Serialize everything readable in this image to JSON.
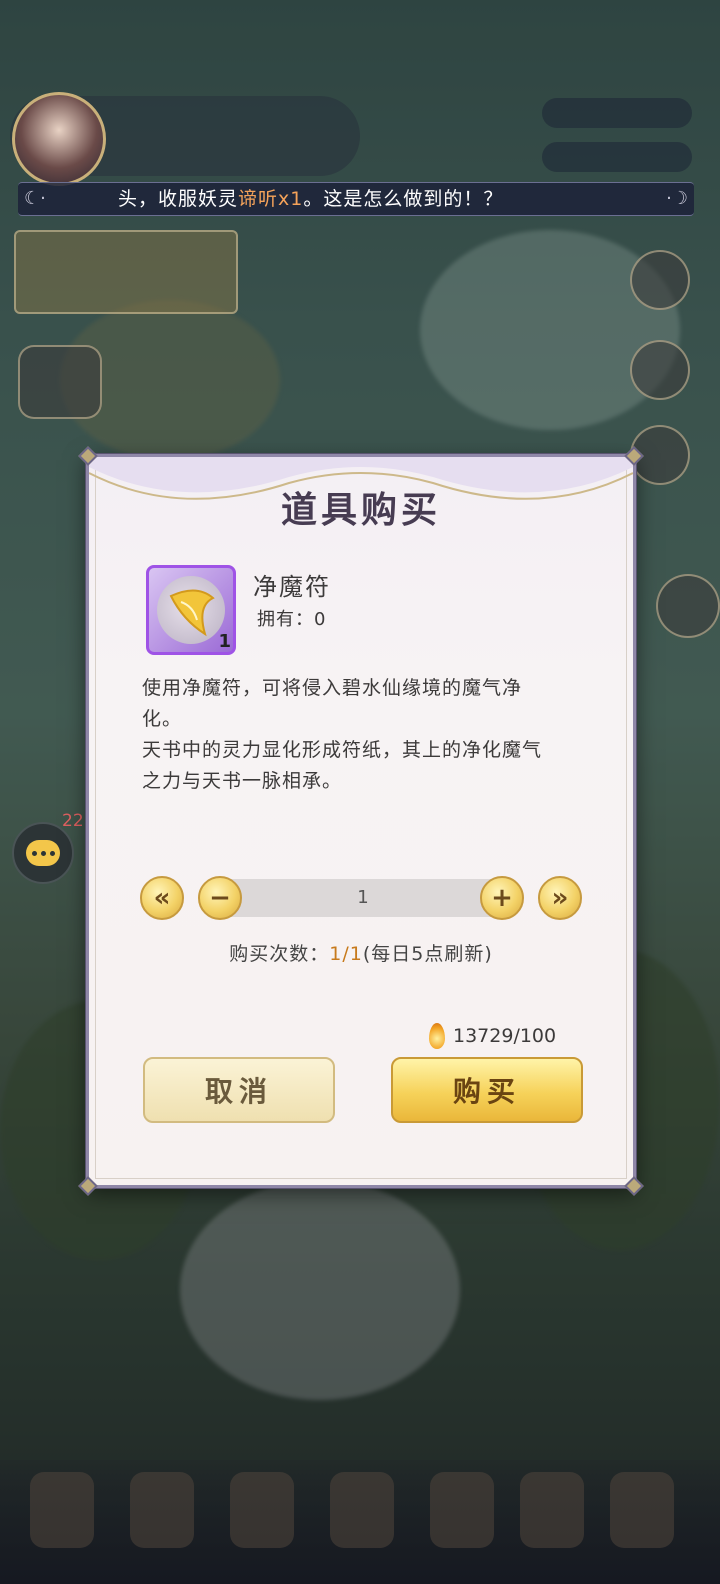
{
  "marquee": {
    "text_before": "头，收服妖灵",
    "highlight": "谛听x1",
    "text_after": "。这是怎么做到的！？"
  },
  "chat": {
    "badge": "22"
  },
  "dialog": {
    "title": "道具购买",
    "item": {
      "name": "净魔符",
      "owned_label": "拥有：0",
      "icon_quantity": "1"
    },
    "description": [
      "使用净魔符，可将侵入碧水仙缘境的魔气净",
      "化。",
      "天书中的灵力显化形成符纸，其上的净化魔气",
      "之力与天书一脉相承。"
    ],
    "quantity": {
      "value": "1",
      "min_label": "«",
      "minus_label": "−",
      "plus_label": "+",
      "max_label": "»"
    },
    "purchase_count": {
      "label": "购买次数：",
      "value": "1/1",
      "note": "(每日5点刷新)"
    },
    "cost": {
      "text": "13729/100",
      "icon": "coin-icon"
    },
    "buttons": {
      "cancel": "取消",
      "buy": "购买"
    }
  },
  "colors": {
    "accent_gold": "#f6d25a",
    "highlight_orange": "#f5a35a",
    "purple_frame": "#9f53e6"
  }
}
